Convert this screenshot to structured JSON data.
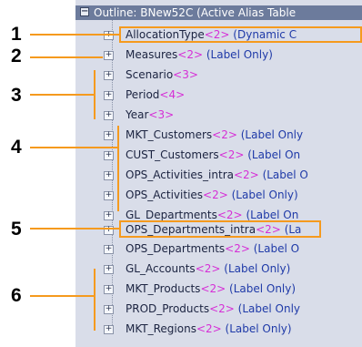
{
  "outline": {
    "title": "Outline: BNew52C (Active Alias Table",
    "toggle_glyph": "−",
    "expand_glyph": "+"
  },
  "rows": [
    {
      "name": "AllocationType",
      "count": "<2>",
      "tag": "(Dynamic C"
    },
    {
      "name": "Measures",
      "count": "<2>",
      "tag": "(Label Only)"
    },
    {
      "name": "Scenario",
      "count": "<3>",
      "tag": ""
    },
    {
      "name": "Period",
      "count": "<4>",
      "tag": ""
    },
    {
      "name": "Year",
      "count": "<3>",
      "tag": ""
    },
    {
      "name": "MKT_Customers",
      "count": "<2>",
      "tag": "(Label Only"
    },
    {
      "name": "CUST_Customers",
      "count": "<2>",
      "tag": "(Label On"
    },
    {
      "name": "OPS_Activities_intra",
      "count": "<2>",
      "tag": "(Label O"
    },
    {
      "name": "OPS_Activities",
      "count": "<2>",
      "tag": "(Label Only)"
    },
    {
      "name": "GL_Departments",
      "count": "<2>",
      "tag": "(Label On"
    },
    {
      "name": "OPS_Departments_intra",
      "count": "<2>",
      "tag": "(La"
    },
    {
      "name": "OPS_Departments",
      "count": "<2>",
      "tag": "(Label O"
    },
    {
      "name": "GL_Accounts",
      "count": "<2>",
      "tag": "(Label Only)"
    },
    {
      "name": "MKT_Products",
      "count": "<2>",
      "tag": "(Label Only)"
    },
    {
      "name": "PROD_Products",
      "count": "<2>",
      "tag": "(Label Only"
    },
    {
      "name": "MKT_Regions",
      "count": "<2>",
      "tag": "(Label Only)"
    }
  ],
  "callouts": [
    "1",
    "2",
    "3",
    "4",
    "5",
    "6"
  ],
  "colors": {
    "highlight": "#f59a1e",
    "member_count": "#d62fd6",
    "label_tag": "#1f3aa8",
    "panel": "#d9dde9",
    "header": "#6c7b9c"
  }
}
